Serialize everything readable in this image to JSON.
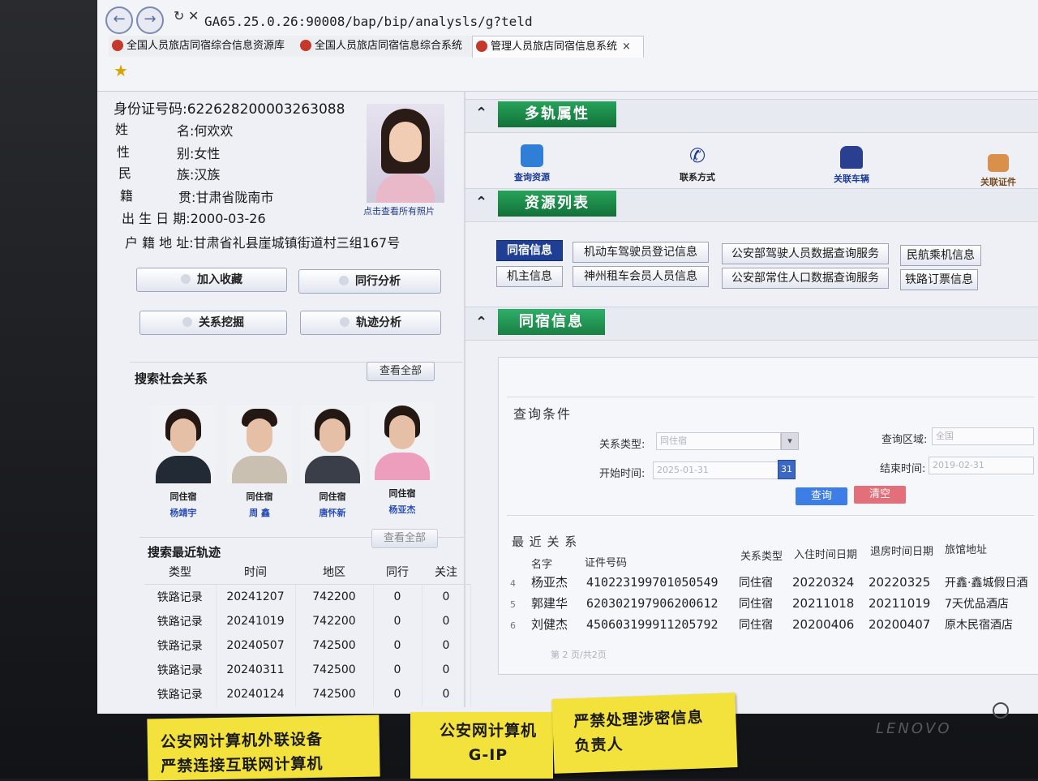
{
  "browser": {
    "address": "GA65.25.0.26:90008/bap/bip/analysls/g?teld",
    "tabs": [
      {
        "label": "全国人员旅店同宿综合信息资源库"
      },
      {
        "label": "全国人员旅店同宿信息综合系统"
      },
      {
        "label": "管理人员旅店同宿信息系统"
      }
    ],
    "close_symbol": "×"
  },
  "person": {
    "id_line": "身份证号码:622628200003263088",
    "name_line": "名:何欢欢",
    "name_prefix": "姓",
    "gender_prefix": "性",
    "gender_line": "别:女性",
    "ethnic_prefix": "民",
    "ethnic_line": "族:汉族",
    "origin_prefix": "籍",
    "origin_line": "贯:甘肃省陇南市",
    "birth_line": "出 生 日 期:2000-03-26",
    "address_line": "户 籍 地 址:甘肃省礼县崖城镇街道村三组167号",
    "view_photos": "点击查看所有照片"
  },
  "actions": {
    "favorite": "加入收藏",
    "travel": "同行分析",
    "relation": "关系挖掘",
    "trajectory": "轨迹分析"
  },
  "social": {
    "title": "搜索社会关系",
    "view_all": "查看全部",
    "people": [
      {
        "relation": "同住宿",
        "name": "杨靖宇"
      },
      {
        "relation": "同住宿",
        "name": "周 鑫"
      },
      {
        "relation": "同住宿",
        "name": "唐怀新"
      },
      {
        "relation": "同住宿",
        "name": "杨亚杰"
      }
    ]
  },
  "tracks": {
    "title": "搜索最近轨迹",
    "view_all": "查看全部",
    "headers": [
      "类型",
      "时间",
      "地区",
      "同行",
      "关注"
    ],
    "rows": [
      [
        "铁路记录",
        "20241207",
        "742200",
        "0",
        "0"
      ],
      [
        "铁路记录",
        "20241019",
        "742200",
        "0",
        "0"
      ],
      [
        "铁路记录",
        "20240507",
        "742500",
        "0",
        "0"
      ],
      [
        "铁路记录",
        "20240311",
        "742500",
        "0",
        "0"
      ],
      [
        "铁路记录",
        "20240124",
        "742500",
        "0",
        "0"
      ]
    ]
  },
  "multi_attr": {
    "title": "多轨属性",
    "items": [
      {
        "label": "查询资源",
        "icon": "globe-search-icon"
      },
      {
        "label": "联系方式",
        "icon": "phone-icon"
      },
      {
        "label": "关联车辆",
        "icon": "car-icon"
      },
      {
        "label": "关联证件",
        "icon": "id-card-icon"
      }
    ]
  },
  "resources": {
    "title": "资源列表",
    "row1": [
      "同宿信息",
      "机动车驾驶员登记信息",
      "公安部驾驶人员数据查询服务",
      "民航乘机信息"
    ],
    "row2": [
      "机主信息",
      "神州租车会员人员信息",
      "公安部常住人口数据查询服务",
      "铁路订票信息"
    ]
  },
  "cohabit": {
    "title": "同宿信息",
    "query_title": "查询条件",
    "relation_type_label": "关系类型:",
    "relation_type_value": "同住宿",
    "region_label": "查询区域:",
    "region_value": "全国",
    "start_label": "开始时间:",
    "start_value": "2025-01-31",
    "end_label": "结束时间:",
    "end_value": "2019-02-31",
    "query_btn": "查询",
    "clear_btn": "清空",
    "recent_title": "最 近 关 系",
    "headers": [
      "名字",
      "证件号码",
      "关系类型",
      "入住时间日期",
      "退房时间日期",
      "旅馆地址"
    ],
    "rows": [
      {
        "idx": "4",
        "name": "杨亚杰",
        "id": "410223199701050549",
        "type": "同住宿",
        "in": "20220324",
        "out": "20220325",
        "hotel": "开鑫·鑫城假日酒"
      },
      {
        "idx": "5",
        "name": "郭建华",
        "id": "620302197906200612",
        "type": "同住宿",
        "in": "20211018",
        "out": "20211019",
        "hotel": "7天优品酒店"
      },
      {
        "idx": "6",
        "name": "刘健杰",
        "id": "450603199911205792",
        "type": "同住宿",
        "in": "20200406",
        "out": "20200407",
        "hotel": "原木民宿酒店"
      }
    ],
    "pager": "第  2  页/共2页"
  },
  "stickers": {
    "s1_line1": "公安网计算机外联设备",
    "s1_line2": "严禁连接互联网计算机",
    "s2_line1": "公安网计算机",
    "s2_line2": "G-IP",
    "s3_line1": "严禁处理涉密信息",
    "s3_line2": "负责人"
  },
  "monitor": {
    "brand": "LENOVO"
  },
  "colors": {
    "accent_green": "#1f8a48",
    "button_blue": "#3d7ee6",
    "button_red": "#e36f7a",
    "selected_nav": "#1e3f94"
  }
}
